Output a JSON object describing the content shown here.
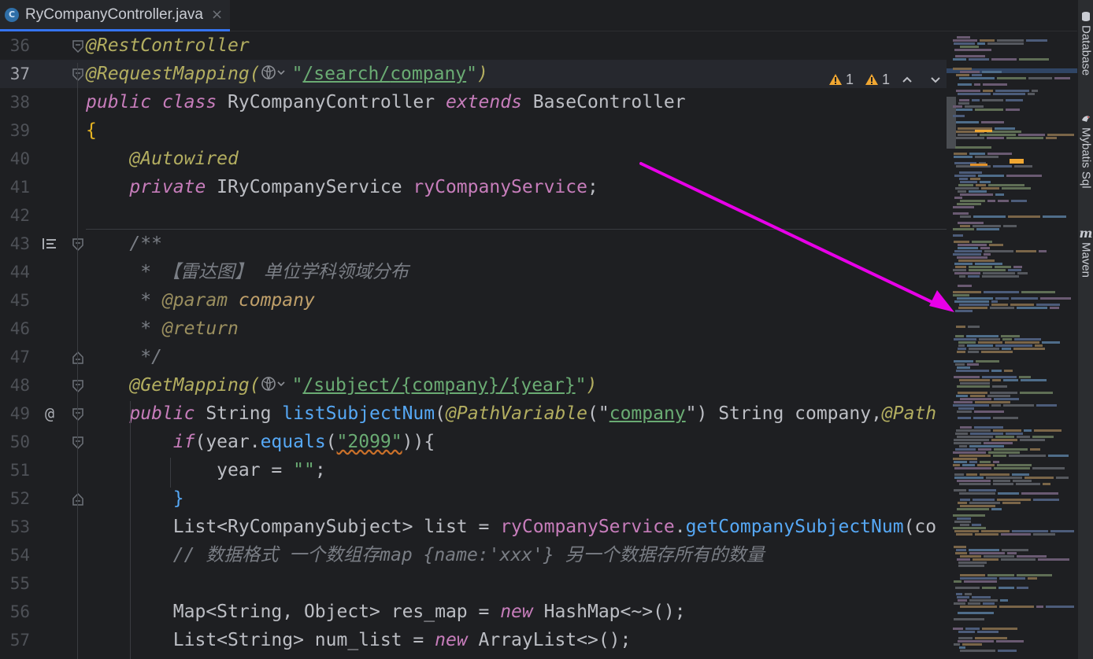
{
  "tab": {
    "filename": "RyCompanyController.java",
    "icon_letter": "C",
    "close_glyph": "×"
  },
  "inspections": {
    "warnings_a": "1",
    "warnings_b": "1",
    "up": "^",
    "down": "v"
  },
  "right_tools": [
    {
      "label": "Database",
      "icon": "database-icon"
    },
    {
      "label": "Mybatis Sql",
      "icon": "mybatis-bird-icon"
    },
    {
      "label": "Maven",
      "icon": "maven-icon"
    }
  ],
  "gutter_marker": "@",
  "lines": [
    {
      "n": "36",
      "parts": [
        {
          "t": "@RestController",
          "c": "ann"
        }
      ]
    },
    {
      "n": "37",
      "parts": [
        {
          "t": "@RequestMapping(",
          "c": "ann"
        },
        {
          "t": "",
          "c": "globe"
        },
        {
          "t": "\"",
          "c": "str"
        },
        {
          "t": "/search/",
          "c": "str ul"
        },
        {
          "t": "company",
          "c": "str ul"
        },
        {
          "t": "\"",
          "c": "str"
        },
        {
          "t": ")",
          "c": "ann"
        }
      ]
    },
    {
      "n": "38",
      "parts": [
        {
          "t": "public ",
          "c": "kwi"
        },
        {
          "t": "class ",
          "c": "kwi"
        },
        {
          "t": "RyCompanyController ",
          "c": ""
        },
        {
          "t": "extends ",
          "c": "kwi"
        },
        {
          "t": "BaseController",
          "c": ""
        }
      ]
    },
    {
      "n": "39",
      "parts": [
        {
          "t": "{",
          "c": "brace"
        }
      ]
    },
    {
      "n": "40",
      "parts": [
        {
          "t": "    ",
          "c": ""
        },
        {
          "t": "@Autowired",
          "c": "ann"
        }
      ]
    },
    {
      "n": "41",
      "parts": [
        {
          "t": "    ",
          "c": ""
        },
        {
          "t": "private ",
          "c": "kwi"
        },
        {
          "t": "IRyCompanyService ",
          "c": ""
        },
        {
          "t": "ryCompanyService",
          "c": "fld"
        },
        {
          "t": ";",
          "c": ""
        }
      ]
    },
    {
      "n": "42",
      "parts": []
    },
    {
      "n": "43",
      "parts": [
        {
          "t": "    ",
          "c": ""
        },
        {
          "t": "/**",
          "c": "cmt"
        }
      ]
    },
    {
      "n": "44",
      "parts": [
        {
          "t": "     ",
          "c": ""
        },
        {
          "t": "* 【雷达图】 单位学科领域分布",
          "c": "cmt"
        }
      ]
    },
    {
      "n": "45",
      "parts": [
        {
          "t": "     ",
          "c": ""
        },
        {
          "t": "* ",
          "c": "cmt"
        },
        {
          "t": "@param",
          "c": "doctag"
        },
        {
          "t": " company",
          "c": "docparam"
        }
      ]
    },
    {
      "n": "46",
      "parts": [
        {
          "t": "     ",
          "c": ""
        },
        {
          "t": "* ",
          "c": "cmt"
        },
        {
          "t": "@return",
          "c": "doctag"
        }
      ]
    },
    {
      "n": "47",
      "parts": [
        {
          "t": "     ",
          "c": ""
        },
        {
          "t": "*/",
          "c": "cmt"
        }
      ]
    },
    {
      "n": "48",
      "parts": [
        {
          "t": "    ",
          "c": ""
        },
        {
          "t": "@GetMapping(",
          "c": "ann"
        },
        {
          "t": "",
          "c": "globe"
        },
        {
          "t": "\"",
          "c": "str"
        },
        {
          "t": "/subject/{company}/{year}",
          "c": "str ul"
        },
        {
          "t": "\"",
          "c": "str"
        },
        {
          "t": ")",
          "c": "ann"
        }
      ]
    },
    {
      "n": "49",
      "parts": [
        {
          "t": "    ",
          "c": ""
        },
        {
          "t": "public ",
          "c": "kwi"
        },
        {
          "t": "String ",
          "c": ""
        },
        {
          "t": "listSubjectNum",
          "c": "mth"
        },
        {
          "t": "(",
          "c": ""
        },
        {
          "t": "@PathVariable",
          "c": "ann"
        },
        {
          "t": "(\"",
          "c": ""
        },
        {
          "t": "company",
          "c": "str ul"
        },
        {
          "t": "\") ",
          "c": ""
        },
        {
          "t": "String ",
          "c": ""
        },
        {
          "t": "company,",
          "c": ""
        },
        {
          "t": "@Path",
          "c": "ann"
        }
      ]
    },
    {
      "n": "50",
      "parts": [
        {
          "t": "        ",
          "c": ""
        },
        {
          "t": "if",
          "c": "kwi"
        },
        {
          "t": "(year.",
          "c": ""
        },
        {
          "t": "equals",
          "c": "mth"
        },
        {
          "t": "(",
          "c": ""
        },
        {
          "t": "\"2099\"",
          "c": "str wavy"
        },
        {
          "t": ")){",
          "c": ""
        }
      ]
    },
    {
      "n": "51",
      "parts": [
        {
          "t": "            ",
          "c": ""
        },
        {
          "t": "year = ",
          "c": ""
        },
        {
          "t": "\"\"",
          "c": "str"
        },
        {
          "t": ";",
          "c": ""
        }
      ]
    },
    {
      "n": "52",
      "parts": [
        {
          "t": "        ",
          "c": ""
        },
        {
          "t": "}",
          "c": "mth"
        }
      ]
    },
    {
      "n": "53",
      "parts": [
        {
          "t": "        ",
          "c": ""
        },
        {
          "t": "List<RyCompanySubject> list = ",
          "c": ""
        },
        {
          "t": "ryCompanyService",
          "c": "fld"
        },
        {
          "t": ".",
          "c": ""
        },
        {
          "t": "getCompanySubjectNum",
          "c": "mth"
        },
        {
          "t": "(co",
          "c": ""
        }
      ]
    },
    {
      "n": "54",
      "parts": [
        {
          "t": "        ",
          "c": ""
        },
        {
          "t": "// 数据格式 一个数组存map {name:'xxx'} 另一个数据存所有的数量",
          "c": "cmt"
        }
      ]
    },
    {
      "n": "55",
      "parts": []
    },
    {
      "n": "56",
      "parts": [
        {
          "t": "        ",
          "c": ""
        },
        {
          "t": "Map<String, Object> res_map = ",
          "c": ""
        },
        {
          "t": "new ",
          "c": "kwi"
        },
        {
          "t": "HashMap",
          "c": ""
        },
        {
          "t": "<~>",
          "c": ""
        },
        {
          "t": "();",
          "c": ""
        }
      ]
    },
    {
      "n": "57",
      "parts": [
        {
          "t": "        ",
          "c": ""
        },
        {
          "t": "List<String> num_list = ",
          "c": ""
        },
        {
          "t": "new ",
          "c": "kwi"
        },
        {
          "t": "ArrayList<>();",
          "c": ""
        }
      ]
    }
  ],
  "colors": {
    "annotation_arrow": "#e800e8",
    "accent": "#3574f0",
    "warning": "#f0a732"
  }
}
